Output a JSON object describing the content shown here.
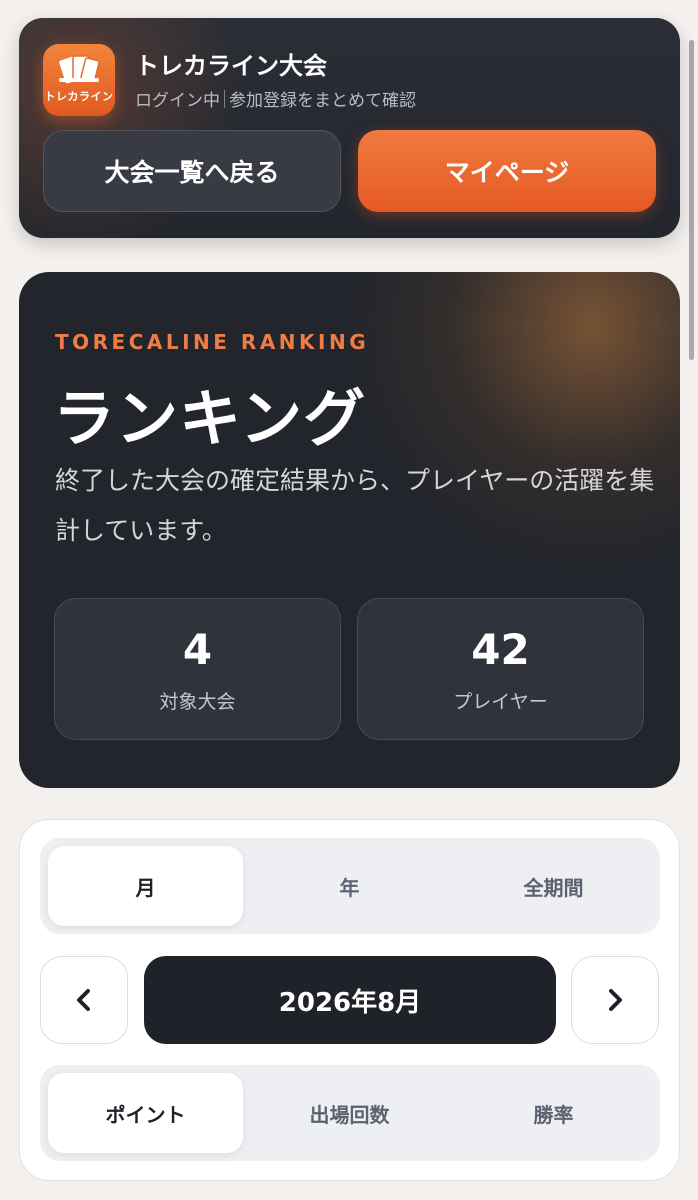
{
  "header": {
    "logo_text": "トレカライン",
    "app_title": "トレカライン大会",
    "status": "ログイン中",
    "subtitle": "参加登録をまとめて確認",
    "back_button": "大会一覧へ戻る",
    "mypage_button": "マイページ"
  },
  "hero": {
    "eyebrow": "TORECALINE RANKING",
    "title": "ランキング",
    "description": "終了した大会の確定結果から、プレイヤーの活躍を集計しています。",
    "stats": [
      {
        "value": "4",
        "label": "対象大会"
      },
      {
        "value": "42",
        "label": "プレイヤー"
      }
    ]
  },
  "filters": {
    "period_tabs": [
      {
        "label": "月",
        "active": true
      },
      {
        "label": "年",
        "active": false
      },
      {
        "label": "全期間",
        "active": false
      }
    ],
    "current_period": "2026年8月",
    "metric_tabs": [
      {
        "label": "ポイント",
        "active": true
      },
      {
        "label": "出場回数",
        "active": false
      },
      {
        "label": "勝率",
        "active": false
      }
    ]
  },
  "colors": {
    "accent": "#e8652c",
    "dark": "#22252c",
    "background": "#f3f0ee"
  },
  "icons": {
    "prev": "chevron-left-icon",
    "next": "chevron-right-icon",
    "logo": "trading-cards-icon"
  }
}
